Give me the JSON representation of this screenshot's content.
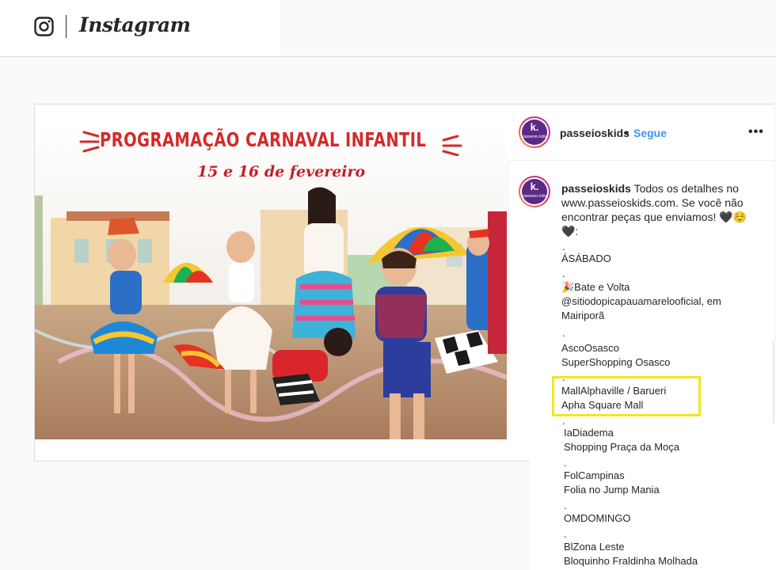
{
  "header": {
    "icon": "instagram-glyph-icon",
    "wordmark": "Instagram"
  },
  "post": {
    "image": {
      "title": "PROGRAMAÇÃO CARNAVAL INFANTIL",
      "subtitle": "15 e 16 de fevereiro"
    },
    "author": {
      "username": "passeioskids",
      "separator": "•",
      "follow_label": "Segue",
      "avatar_text": "k.",
      "avatar_subtext": "passeios kids"
    },
    "more_label": "•••",
    "caption": {
      "username": "passeioskids",
      "text": "Todos os detalhes no www.passeioskids.com. Se você não encontrar peças que enviamos! 🖤☺️ 🖤:",
      "lines": [
        ".",
        "ÁSÁBADO",
        ".",
        "🎉Bate e Volta",
        "@sitiodopicapauamarelooficial, em",
        "Mairiporã",
        ".",
        "AscoOsasco",
        "SuperShopping Osasco",
        ".",
        "MallAlphaville / Barueri",
        "Apha Square Mall",
        ".",
        "IaDiadema",
        "Shopping Praça da Moça",
        ".",
        "FolCampinas",
        "Folia no Jump Mania",
        ".",
        "OMDOMINGO",
        ".",
        "BlZona Leste",
        "Bloquinho Fraldinha Molhada"
      ]
    }
  },
  "colors": {
    "link_blue": "#3897f0",
    "highlight_yellow": "#f5e51c",
    "title_red": "#d42a2a"
  }
}
